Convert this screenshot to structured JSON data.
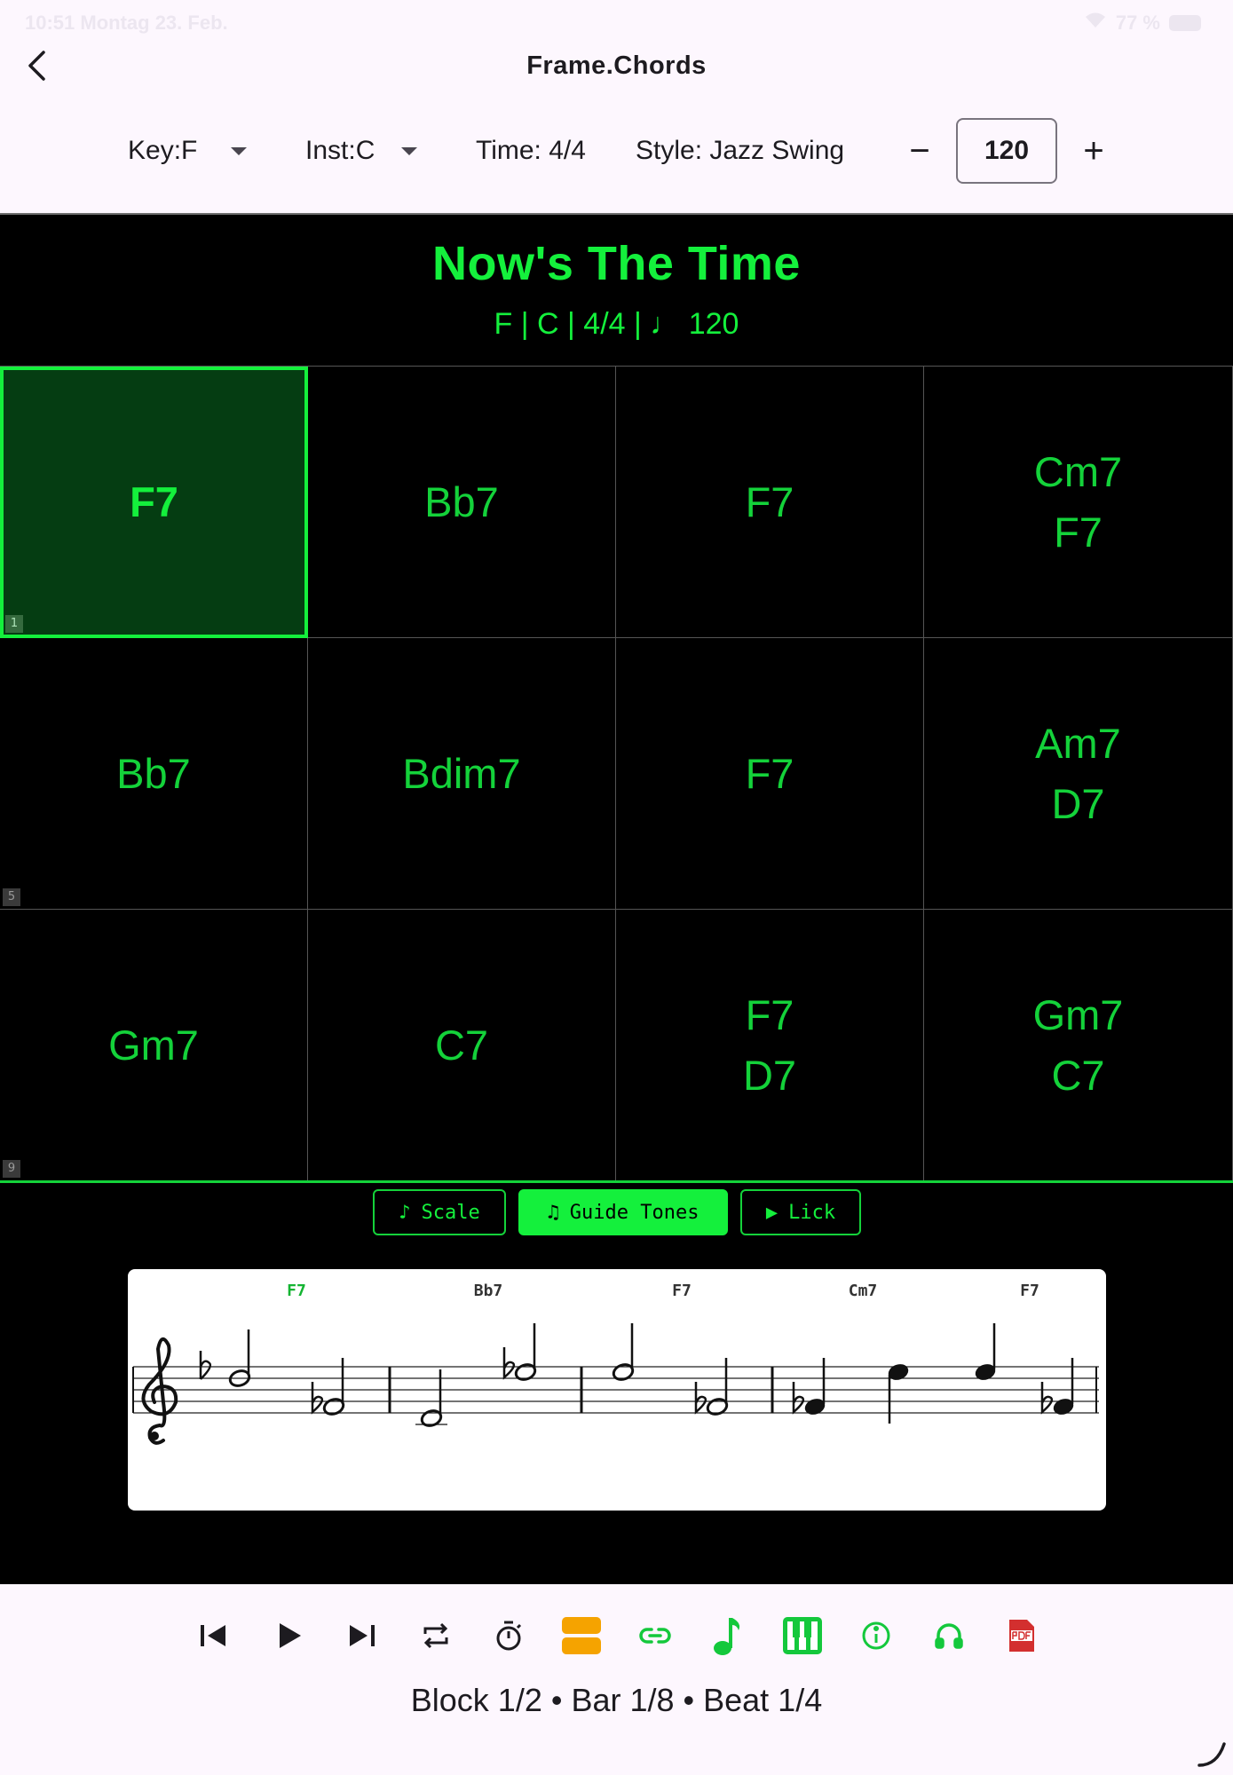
{
  "status_bar": {
    "time_date": "10:51  Montag 23. Feb.",
    "battery": "77 %"
  },
  "app": {
    "title": "Frame.Chords"
  },
  "controls": {
    "key_label": "Key:F",
    "inst_label": "Inst:C",
    "time_label": "Time: 4/4",
    "style_label": "Style: Jazz Swing",
    "tempo_value": "120",
    "decrease_symbol": "−",
    "increase_symbol": "+"
  },
  "song": {
    "title": "Now's The Time",
    "meta": "F | C | 4/4 | ♩ 120"
  },
  "chord_grid": {
    "active_bar": 1,
    "cells": [
      {
        "chords": [
          "F7"
        ]
      },
      {
        "chords": [
          "Bb7"
        ]
      },
      {
        "chords": [
          "F7"
        ]
      },
      {
        "chords": [
          "Cm7",
          "F7"
        ]
      },
      {
        "chords": [
          "Bb7"
        ]
      },
      {
        "chords": [
          "Bdim7"
        ]
      },
      {
        "chords": [
          "F7"
        ]
      },
      {
        "chords": [
          "Am7",
          "D7"
        ]
      },
      {
        "chords": [
          "Gm7"
        ]
      },
      {
        "chords": [
          "C7"
        ]
      },
      {
        "chords": [
          "F7",
          "D7"
        ]
      },
      {
        "chords": [
          "Gm7",
          "C7"
        ]
      }
    ],
    "row_numbers": [
      "1",
      "5",
      "9"
    ]
  },
  "modes": {
    "scale_label": "Scale",
    "scale_icon": "♪",
    "guide_tones_label": "Guide Tones",
    "guide_tones_icon": "♫",
    "lick_label": "Lick",
    "lick_icon": "▶",
    "selected": "guide_tones"
  },
  "notation": {
    "chord_labels": [
      "F7",
      "Bb7",
      "F7",
      "Cm7",
      "F7"
    ],
    "active_chord_index": 0,
    "key_signature": "F major (one flat)",
    "clef": "treble"
  },
  "toolbar": {
    "icons": [
      "skip-previous-icon",
      "play-icon",
      "skip-next-icon",
      "repeat-icon",
      "timer-icon",
      "layout-icon",
      "link-icon",
      "music-note-icon",
      "piano-icon",
      "info-icon",
      "headphones-icon",
      "pdf-icon"
    ],
    "colors": {
      "dark": "#1d1b20",
      "orange": "#f5a300",
      "green": "#14c83c",
      "red": "#d32f2f"
    }
  },
  "position": {
    "text": "Block 1/2 • Bar 1/8 • Beat 1/4"
  },
  "colors": {
    "accent_green": "#14f03c",
    "active_cell_bg": "#053d12",
    "background": "#000000"
  }
}
